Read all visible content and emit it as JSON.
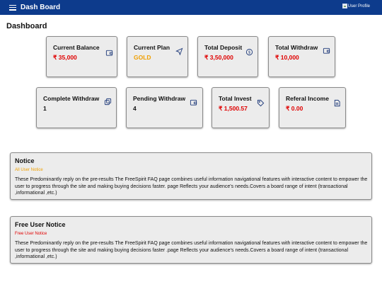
{
  "header": {
    "brand": "Dash Board",
    "menu_icon": "hamburger-icon",
    "profile_alt": "User Profile",
    "background_color": "#0d3b8c"
  },
  "page_title": "Dashboard",
  "cards": [
    {
      "label": "Current Balance",
      "value": "₹ 35,000",
      "value_color": "#e00000",
      "icon": "wallet-icon"
    },
    {
      "label": "Current Plan",
      "value": "GOLD",
      "value_color": "#f0a000",
      "icon": "send-icon"
    },
    {
      "label": "Total Deposit",
      "value": "₹ 3,50,000",
      "value_color": "#e00000",
      "icon": "dollar-circle-icon"
    },
    {
      "label": "Total Withdraw",
      "value": "₹ 10,000",
      "value_color": "#e00000",
      "icon": "wallet-icon"
    },
    {
      "label": "Complete Withdraw",
      "value": "1",
      "value_color": "#111111",
      "icon": "copy-icon"
    },
    {
      "label": "Pending Withdraw",
      "value": "4",
      "value_color": "#111111",
      "icon": "wallet-icon"
    },
    {
      "label": "Total Invest",
      "value": "₹ 1,500.57",
      "value_color": "#e00000",
      "icon": "tag-icon"
    },
    {
      "label": "Referal Income",
      "value": "₹ 0.00",
      "value_color": "#e00000",
      "icon": "document-icon"
    }
  ],
  "notices": [
    {
      "title": "Notice",
      "subtitle": "All User Notice",
      "subtitle_color": "#f0a000",
      "body": "These Predominantly reply on the pre-results The FreeSpirit FAQ page combines useful information navigational features with interactive content to empower the user to progress through the site and making buying decisions faster. page Reflects your audience's needs.Covers a board range of intent (transactional ,informational ,etc.)"
    },
    {
      "title": "Free User Notice",
      "subtitle": "Free User Notice",
      "subtitle_color": "#e00000",
      "body": "These Predominantly reply on the pre-results The FreeSpirit FAQ page combines useful information navigational features with interactive content to empower the user to progress through the site and making buying decisions faster .page Reflects your audience's needs.Covers a board range of intent (transactional ,informational ,etc.)"
    }
  ]
}
